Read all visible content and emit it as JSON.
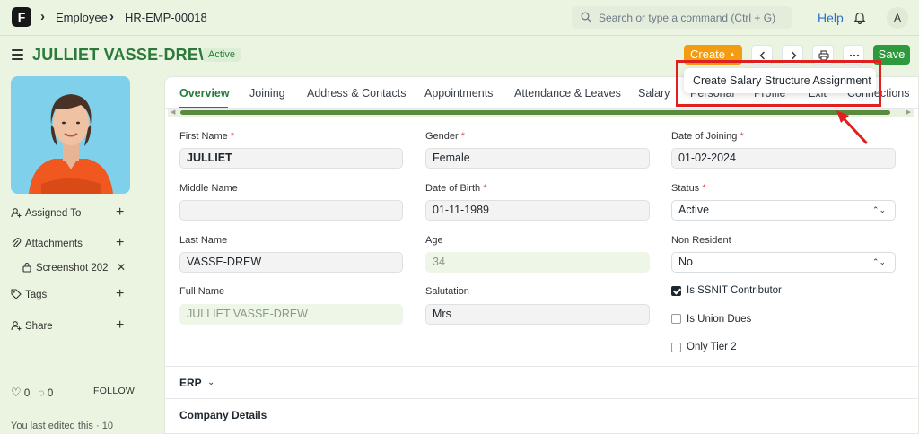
{
  "nav": {
    "logo": "F",
    "breadcrumbs": [
      "Employee",
      "HR-EMP-00018"
    ],
    "search_placeholder": "Search or type a command (Ctrl + G)",
    "help": "Help",
    "avatar": "A"
  },
  "header": {
    "title": "JULLIET VASSE-DREW",
    "status": "Active",
    "create_label": "Create",
    "save_label": "Save"
  },
  "dropdown": {
    "item": "Create Salary Structure Assignment"
  },
  "sidebar": {
    "assigned_to": "Assigned To",
    "attachments": "Attachments",
    "attachment_file": "Screenshot 202",
    "tags": "Tags",
    "share": "Share",
    "likes": "0",
    "comments": "0",
    "follow": "FOLLOW",
    "edited": "You last edited this · 10"
  },
  "tabs": [
    "Overview",
    "Joining",
    "Address & Contacts",
    "Appointments",
    "Attendance & Leaves",
    "Salary",
    "Personal",
    "Profile",
    "Exit",
    "Connections"
  ],
  "form": {
    "first_name_label": "First Name",
    "first_name": "JULLIET",
    "middle_name_label": "Middle Name",
    "middle_name": "",
    "last_name_label": "Last Name",
    "last_name": "VASSE-DREW",
    "full_name_label": "Full Name",
    "full_name": "JULLIET VASSE-DREW",
    "gender_label": "Gender",
    "gender": "Female",
    "dob_label": "Date of Birth",
    "dob": "01-11-1989",
    "age_label": "Age",
    "age": "34",
    "salutation_label": "Salutation",
    "salutation": "Mrs",
    "doj_label": "Date of Joining",
    "doj": "01-02-2024",
    "status_label": "Status",
    "status": "Active",
    "non_resident_label": "Non Resident",
    "non_resident": "No",
    "ssnit_label": "Is SSNIT Contributor",
    "ssnit_checked": true,
    "union_label": "Is Union Dues",
    "union_checked": false,
    "tier2_label": "Only Tier 2",
    "tier2_checked": false,
    "required_mark": "*"
  },
  "sections": {
    "erp": "ERP",
    "company": "Company Details"
  },
  "colors": {
    "accent": "#2b7a3c",
    "create": "#f39c12",
    "save": "#2e9a3d",
    "highlight": "#e0201e"
  }
}
